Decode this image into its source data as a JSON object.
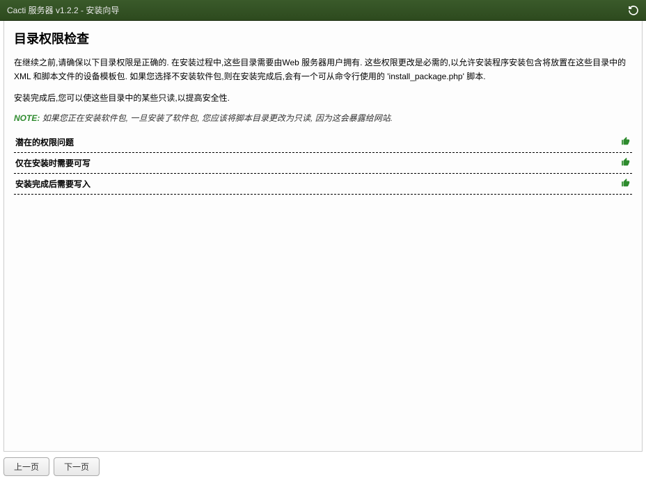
{
  "header": {
    "title": "Cacti 服务器 v1.2.2 - 安装向导"
  },
  "main": {
    "pageTitle": "目录权限检查",
    "paragraph1": "在继续之前,请确保以下目录权限是正确的. 在安装过程中,这些目录需要由Web 服务器用户拥有. 这些权限更改是必需的,以允许安装程序安装包含将放置在这些目录中的XML 和脚本文件的设备模板包. 如果您选择不安装软件包,则在安装完成后,会有一个可从命令行使用的 'install_package.php' 脚本.",
    "paragraph2": "安装完成后,您可以使这些目录中的某些只读,以提高安全性.",
    "noteLabel": "NOTE:",
    "noteText": " 如果您正在安装软件包, 一旦安装了软件包, 您应该将脚本目录更改为只读, 因为这会暴露给网站.",
    "sections": [
      {
        "label": "潜在的权限问题",
        "status": "ok"
      },
      {
        "label": "仅在安装时需要可写",
        "status": "ok"
      },
      {
        "label": "安装完成后需要写入",
        "status": "ok"
      }
    ]
  },
  "footer": {
    "prevLabel": "上一页",
    "nextLabel": "下一页"
  }
}
